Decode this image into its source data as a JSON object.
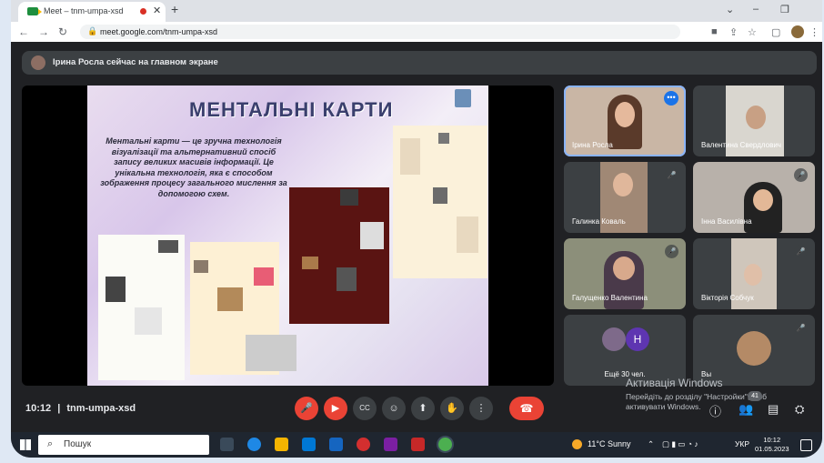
{
  "browser": {
    "tab_title": "Meet – tnm-umpa-xsd",
    "tab_close": "✕",
    "new_tab": "+",
    "url": "meet.google.com/tnm-umpa-xsd"
  },
  "meet": {
    "presenting_banner": "Ірина Росла сейчас на главном экране",
    "meeting_time": "10:12",
    "separator": "|",
    "meeting_code": "tnm-umpa-xsd",
    "more_count": "41"
  },
  "slide": {
    "title": "МЕНТАЛЬНІ КАРТИ",
    "body": "Ментальні карти — це зручна технологія візуалізації та альтернативний спосіб запису великих масивів інформації. Це унікальна технологія, яка є способом зображення процесу загального мислення за допомогою схем."
  },
  "participants": [
    {
      "name": "Ірина Росла"
    },
    {
      "name": "Валентина Свердлович"
    },
    {
      "name": "Галинка Коваль"
    },
    {
      "name": "Інна Василівна"
    },
    {
      "name": "Галущенко Валентина"
    },
    {
      "name": "Вікторія Собчук"
    },
    {
      "name": "Ещё 30 чел.",
      "avatar_letter": "H"
    },
    {
      "name": "Вы"
    }
  ],
  "windows_activation": {
    "line1": "Активація Windows",
    "line2": "Перейдіть до розділу \"Настройки\", щоб активувати Windows."
  },
  "taskbar": {
    "search_placeholder": "Пошук",
    "weather": "11°C  Sunny",
    "language": "УКР",
    "time": "10:12",
    "date": "01.05.2023"
  },
  "colors": {
    "meet_bg": "#202124",
    "tile_bg": "#3c4043",
    "end_call": "#ea4335",
    "active_speaker_border": "#8ab4f8"
  }
}
